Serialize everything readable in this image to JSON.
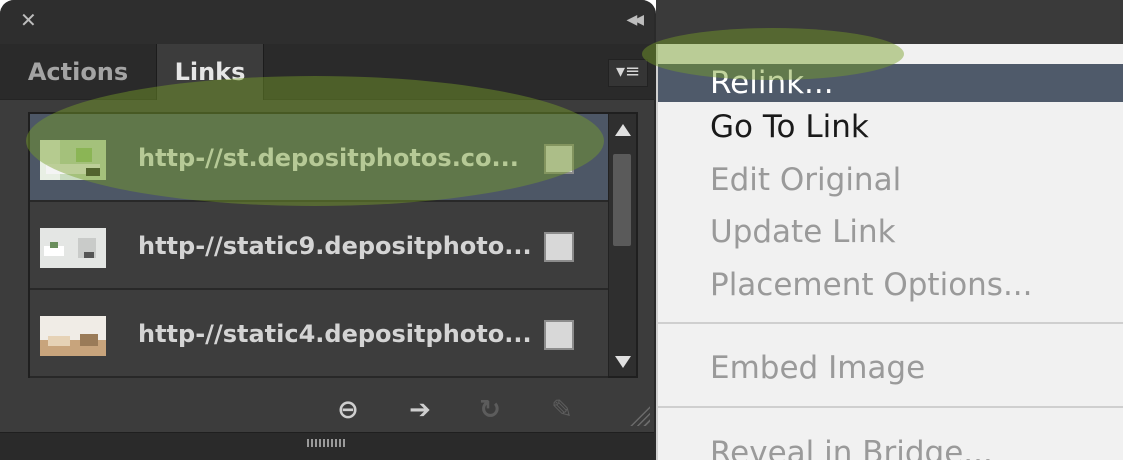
{
  "panel": {
    "tabs": [
      {
        "label": "Actions",
        "active": false
      },
      {
        "label": "Links",
        "active": true
      }
    ],
    "links": [
      {
        "name": "http-//st.depositphotos.co...",
        "selected": true
      },
      {
        "name": "http-//static9.depositphoto...",
        "selected": false
      },
      {
        "name": "http-//static4.depositphoto...",
        "selected": false
      }
    ],
    "toolbar_icons": [
      "relink-icon",
      "go-to-link-icon",
      "update-link-icon",
      "edit-original-icon"
    ]
  },
  "menu": {
    "items": [
      {
        "label": "Relink...",
        "state": "highlighted"
      },
      {
        "label": "Go To Link",
        "state": "enabled"
      },
      {
        "label": "Edit Original",
        "state": "disabled"
      },
      {
        "label": "Update Link",
        "state": "disabled"
      },
      {
        "label": "Placement Options...",
        "state": "disabled"
      },
      {
        "label": "Embed Image",
        "state": "disabled"
      },
      {
        "label": "Reveal in Bridge...",
        "state": "disabled"
      }
    ]
  },
  "colors": {
    "panel_bg": "#3c3c3c",
    "selected_row": "#4d5766",
    "menu_highlight": "#4f5a6a",
    "annotation_highlight": "#78a028"
  }
}
